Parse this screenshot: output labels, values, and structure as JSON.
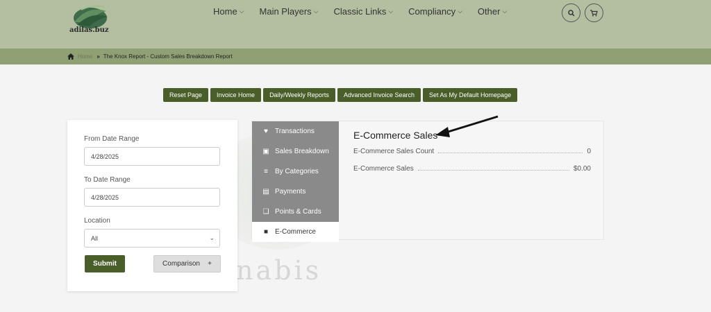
{
  "brand": {
    "name": "adilas.buz"
  },
  "nav": {
    "items": [
      "Home",
      "Main Players",
      "Classic Links",
      "Compliancy",
      "Other"
    ]
  },
  "breadcrumb": {
    "home": "Home",
    "current": "The Knox Report - Custom Sales Breakdown Report"
  },
  "action_buttons": [
    "Reset Page",
    "Invoice Home",
    "Daily/Weekly Reports",
    "Advanced Invoice Search",
    "Set As My Default Homepage"
  ],
  "filters": {
    "from_label": "From Date Range",
    "from_value": "4/28/2025",
    "to_label": "To Date Range",
    "to_value": "4/28/2025",
    "location_label": "Location",
    "location_value": "All",
    "submit_label": "Submit",
    "comparison_label": "Comparison",
    "comparison_icon": "+"
  },
  "side_menu": [
    {
      "label": "Transactions",
      "icon": "heart-pulse-icon"
    },
    {
      "label": "Sales Breakdown",
      "icon": "money-icon"
    },
    {
      "label": "By Categories",
      "icon": "list-icon"
    },
    {
      "label": "Payments",
      "icon": "credit-card-icon"
    },
    {
      "label": "Points & Cards",
      "icon": "gift-icon"
    },
    {
      "label": "E-Commerce",
      "icon": "shopping-bag-icon"
    }
  ],
  "report": {
    "title": "E-Commerce Sales",
    "rows": [
      {
        "label": "E-Commerce Sales Count",
        "value": "0"
      },
      {
        "label": "E-Commerce Sales",
        "value": "$0.00"
      }
    ]
  },
  "watermark": {
    "text": "nabis"
  },
  "colors": {
    "header": "#b3bfa0",
    "breadcrumb": "#8fa075",
    "accent": "#4a5e2a",
    "menu": "#8a8a8a"
  }
}
